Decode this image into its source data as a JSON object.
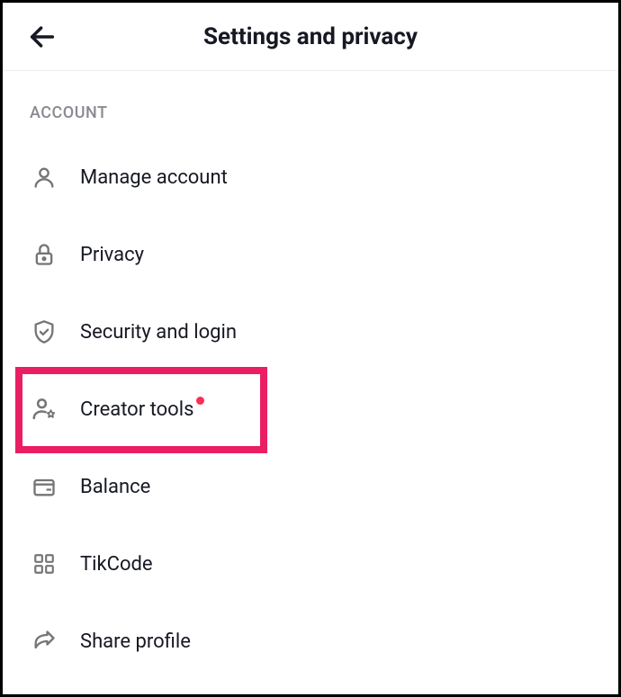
{
  "header": {
    "title": "Settings and privacy"
  },
  "section": {
    "label": "ACCOUNT"
  },
  "menu": {
    "items": [
      {
        "label": "Manage account",
        "icon": "person-icon"
      },
      {
        "label": "Privacy",
        "icon": "lock-icon"
      },
      {
        "label": "Security and login",
        "icon": "shield-icon"
      },
      {
        "label": "Creator tools",
        "icon": "person-star-icon",
        "dot": true,
        "highlighted": true
      },
      {
        "label": "Balance",
        "icon": "wallet-icon"
      },
      {
        "label": "TikCode",
        "icon": "qr-icon"
      },
      {
        "label": "Share profile",
        "icon": "share-icon"
      }
    ]
  }
}
